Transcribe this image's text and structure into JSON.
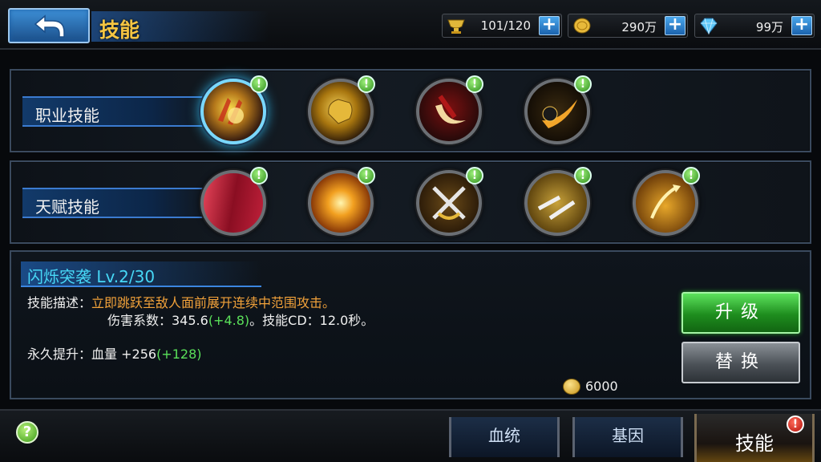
{
  "header": {
    "title": "技能",
    "stamina": "101/120",
    "gold": "290万",
    "diamonds": "99万"
  },
  "rows": [
    {
      "label": "职业技能",
      "skills": [
        {
          "name": "claw-slash-skill",
          "selected": true,
          "badge": "!"
        },
        {
          "name": "golden-punch-skill",
          "selected": false,
          "badge": "!"
        },
        {
          "name": "crescent-blade-skill",
          "selected": false,
          "badge": "!"
        },
        {
          "name": "fire-comet-skill",
          "selected": false,
          "badge": "!"
        }
      ]
    },
    {
      "label": "天赋技能",
      "skills": [
        {
          "name": "red-curtain-skill",
          "badge": "!"
        },
        {
          "name": "burst-star-skill",
          "badge": "!"
        },
        {
          "name": "crossed-swords-skill",
          "badge": "!"
        },
        {
          "name": "twin-daggers-skill",
          "badge": "!"
        },
        {
          "name": "rising-arrows-skill",
          "badge": "!"
        }
      ]
    }
  ],
  "detail": {
    "title": "闪烁突袭 Lv.2/30",
    "desc_label": "技能描述：",
    "desc_text": "立即跳跃至敌人面前展开连续中范围攻击。",
    "damage_prefix": "伤害系数：345.6",
    "damage_bonus": "(+4.8)",
    "damage_suffix": "。技能CD：12.0秒。",
    "perm_label": "永久提升：",
    "perm_value": "血量 +256",
    "perm_bonus": "(+128)",
    "upgrade_label": "升级",
    "replace_label": "替换",
    "cost": "6000"
  },
  "tabs": {
    "bloodline": "血统",
    "gene": "基因",
    "skill": "技能",
    "alert": "!"
  },
  "help": "?"
}
